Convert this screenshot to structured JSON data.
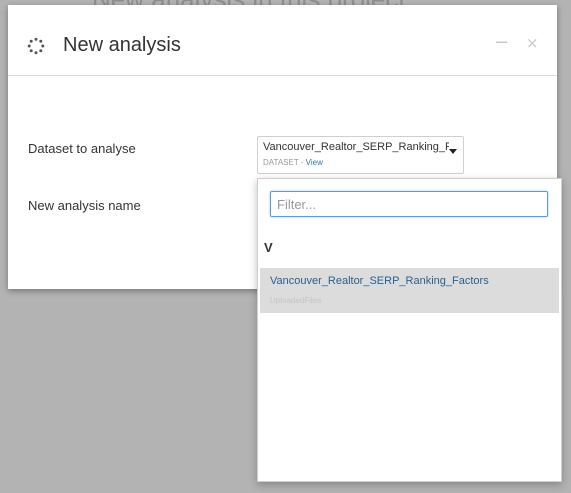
{
  "background": {
    "text": "New analysis in this project"
  },
  "modal": {
    "title": "New analysis",
    "icon": "spinner-icon",
    "minimize_label": "−",
    "close_label": "×"
  },
  "form": {
    "dataset_label": "Dataset to analyse",
    "name_label": "New analysis name",
    "dataset_value": "Vancouver_Realtor_SERP_Ranking_Factors",
    "dataset_type": "DATASET",
    "dataset_separator": " - ",
    "dataset_view_link": "View"
  },
  "dropdown": {
    "filter_placeholder": "Filter...",
    "group_header": "V",
    "options": [
      {
        "name": "Vancouver_Realtor_SERP_Ranking_Factors",
        "subtitle": "UploadedFiles"
      }
    ]
  },
  "colors": {
    "overlay": "#b3b3b3",
    "link": "#2b7bb9",
    "option_highlight": "#dcdcdc",
    "focus_border": "#5b9dd9"
  }
}
